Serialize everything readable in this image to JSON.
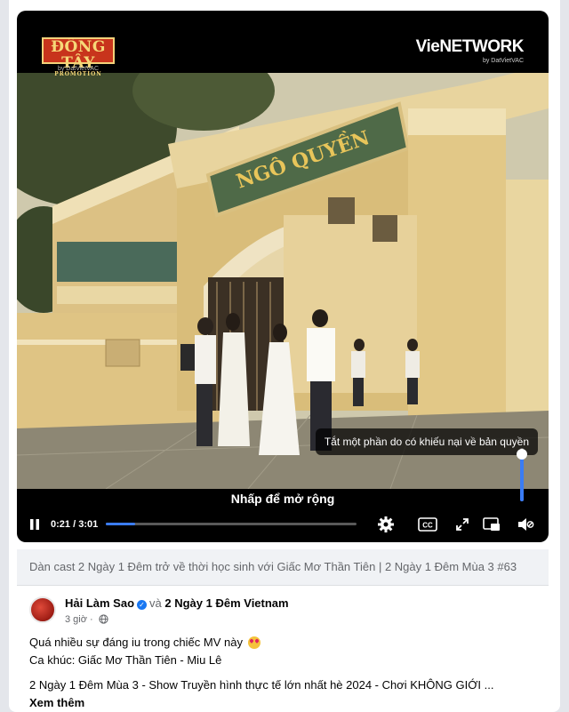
{
  "player": {
    "logo_left": {
      "main": "ĐÔNG TÂY",
      "tag": "PROMOTION",
      "sub": "by DatVietVAC"
    },
    "logo_right": {
      "main": "VieNETWORK",
      "sub": "by DatVietVAC"
    },
    "copyright_notice": "Tắt một phần do có khiếu nại về bản quyền",
    "expand_hint": "Nhấp để mở rộng",
    "current_time": "0:21",
    "duration": "3:01",
    "progress_fraction": 0.116,
    "volume_fraction": 0.88,
    "accent_color": "#3a7cf5",
    "controls": {
      "pause_icon": "pause-icon",
      "settings_icon": "gear-icon",
      "captions_label": "CC",
      "expand_icon": "expand-icon",
      "miniplayer_icon": "miniplayer-icon",
      "volume_icon": "volume-muted-icon"
    }
  },
  "video_title": "Dàn cast 2 Ngày 1 Đêm trở về thời học sinh với Giấc Mơ Thần Tiên | 2 Ngày 1 Đêm Mùa 3 #63",
  "post": {
    "author": "Hải Làm Sao",
    "conjunction": "và",
    "page": "2 Ngày 1 Đêm Vietnam",
    "time": "3 giờ",
    "lines": [
      "Quá nhiều sự đáng iu trong chiếc MV này",
      "Ca khúc: Giấc Mơ Thần Tiên - Miu Lê",
      "2 Ngày 1 Đêm Mùa 3 - Show Truyền hình thực tế lớn nhất hè 2024 - Chơi KHÔNG GIỚI ..."
    ],
    "see_more": "Xem thêm"
  }
}
